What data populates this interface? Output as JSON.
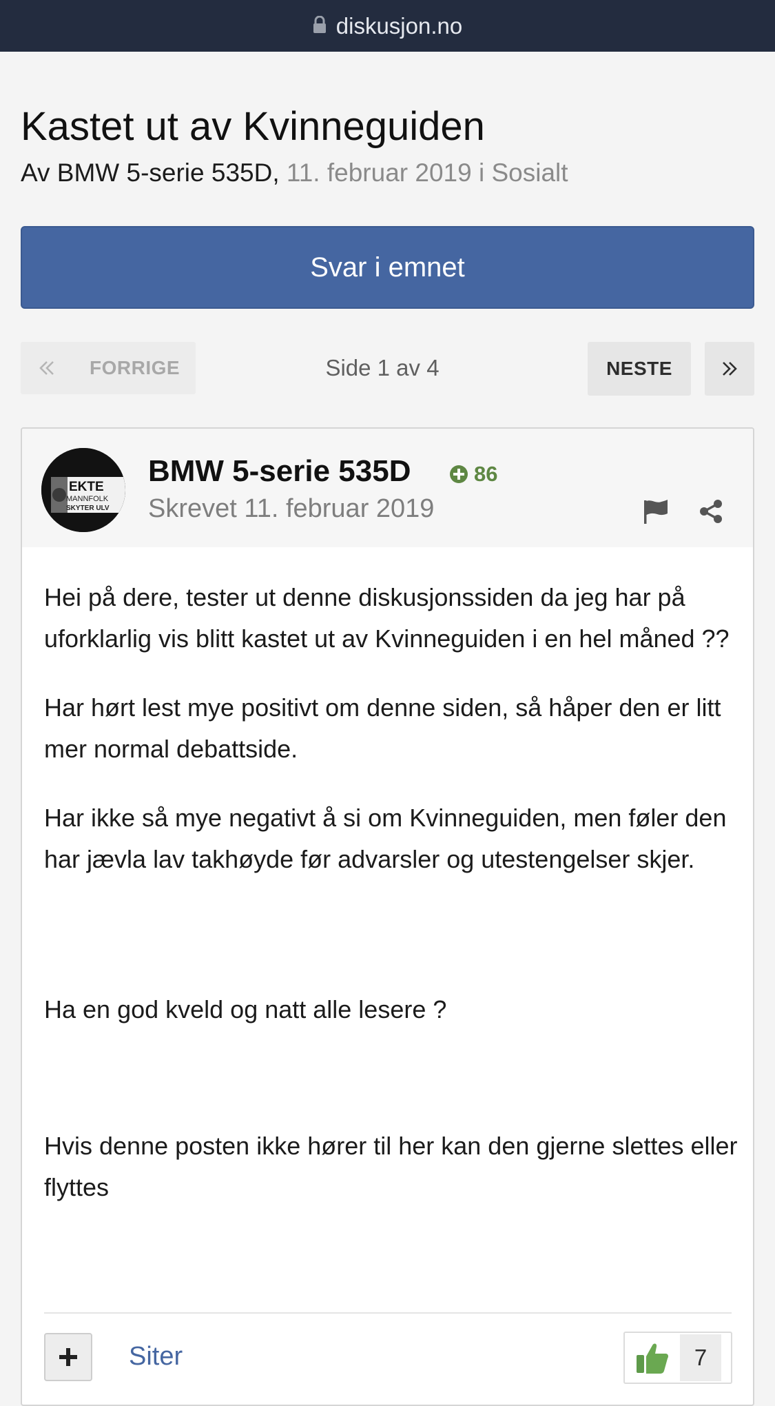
{
  "browser": {
    "url": "diskusjon.no"
  },
  "topic": {
    "title": "Kastet ut av Kvinneguiden",
    "by_prefix": "Av BMW 5-serie 535D,",
    "date_forum": "11. februar 2019 i Sosialt"
  },
  "actions": {
    "reply_label": "Svar i emnet"
  },
  "pagination": {
    "prev_label": "FORRIGE",
    "page_info": "Side 1 av 4",
    "next_label": "NESTE"
  },
  "post": {
    "author": "BMW 5-serie 535D",
    "reputation": "86",
    "posted": "Skrevet 11. februar 2019",
    "avatar_text": [
      "EKTE",
      "MANNFOLK",
      "SKYTER ULV"
    ],
    "paragraphs": [
      "Hei på dere, tester ut denne diskusjonssiden da jeg har på uforklarlig vis blitt kastet ut av Kvinneguiden i en hel måned ??",
      "Har hørt lest mye positivt om denne siden, så håper den er litt mer normal debattside.",
      "Har ikke så mye negativt å si om Kvinneguiden, men føler den har jævla lav takhøyde før advarsler og utestengelser skjer.",
      "Ha en god kveld og natt alle lesere ?",
      "Hvis denne posten ikke hører til her kan den gjerne slettes eller flyttes"
    ],
    "quote_label": "Siter",
    "like_count": "7"
  },
  "colors": {
    "url_bar": "#232c3f",
    "primary_button": "#4566a1",
    "reputation_green": "#5e8743",
    "link_blue": "#4566a1"
  },
  "icons": [
    "lock-icon",
    "double-chevron-left-icon",
    "double-chevron-right-icon",
    "plus-circle-icon",
    "flag-icon",
    "share-icon",
    "plus-icon",
    "thumbs-up-icon"
  ]
}
